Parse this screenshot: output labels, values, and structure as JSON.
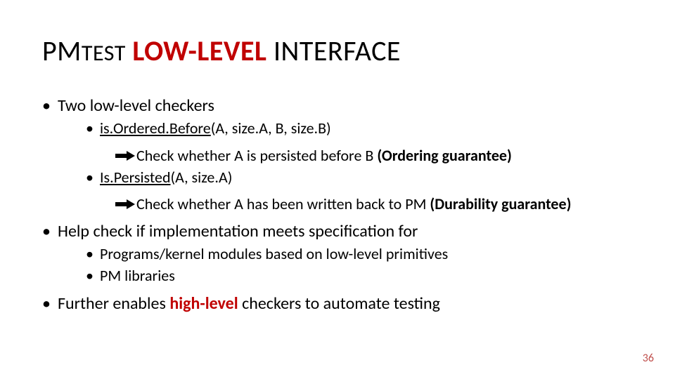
{
  "title": {
    "pm": "PM",
    "est": "TEST",
    "lowlevel": "LOW-LEVEL",
    "interface": "INTERFACE"
  },
  "b1": "Two low-level checkers",
  "b1_sub1_fn": "is.Ordered.Before",
  "b1_sub1_args": "(A, size.A, B, size.B)",
  "b1_sub1_desc_pre": "Check whether A is persisted before B ",
  "b1_sub1_desc_bold": "(Ordering guarantee)",
  "b1_sub2_fn": "Is.Persisted",
  "b1_sub2_args": "(A, size.A)",
  "b1_sub2_desc_pre": "Check whether A has been written back to PM ",
  "b1_sub2_desc_bold": "(Durability guarantee)",
  "b2": "Help check if implementation meets specification for",
  "b2_sub1": "Programs/kernel modules based on low-level primitives",
  "b2_sub2": "PM libraries",
  "b3_pre": "Further enables ",
  "b3_red": "high-level",
  "b3_post": " checkers to automate testing",
  "pagenum": "36"
}
